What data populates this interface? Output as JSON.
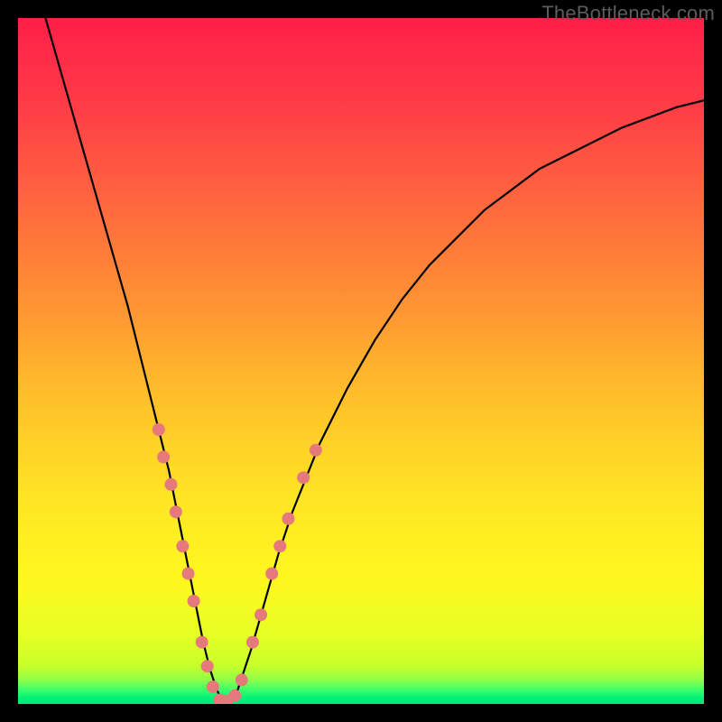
{
  "watermark": "TheBottleneck.com",
  "chart_data": {
    "type": "line",
    "title": "",
    "xlabel": "",
    "ylabel": "",
    "xlim": [
      0,
      100
    ],
    "ylim": [
      0,
      100
    ],
    "curve": {
      "name": "bottleneck-curve",
      "x": [
        4,
        6,
        8,
        10,
        12,
        14,
        16,
        18,
        20,
        22,
        24,
        26,
        27,
        28,
        29,
        30,
        31,
        32,
        34,
        36,
        38,
        40,
        44,
        48,
        52,
        56,
        60,
        64,
        68,
        72,
        76,
        80,
        84,
        88,
        92,
        96,
        100
      ],
      "y": [
        100,
        93,
        86,
        79,
        72,
        65,
        58,
        50,
        42,
        34,
        24,
        14,
        9,
        5,
        2,
        0,
        0,
        2,
        8,
        15,
        22,
        28,
        38,
        46,
        53,
        59,
        64,
        68,
        72,
        75,
        78,
        80,
        82,
        84,
        85.5,
        87,
        88
      ]
    },
    "dots": {
      "name": "highlight-points",
      "color": "#e6797b",
      "radius_px": 7,
      "points": [
        {
          "x": 20.5,
          "y": 40
        },
        {
          "x": 21.2,
          "y": 36
        },
        {
          "x": 22.3,
          "y": 32
        },
        {
          "x": 23.0,
          "y": 28
        },
        {
          "x": 24.0,
          "y": 23
        },
        {
          "x": 24.8,
          "y": 19
        },
        {
          "x": 25.6,
          "y": 15
        },
        {
          "x": 26.8,
          "y": 9
        },
        {
          "x": 27.6,
          "y": 5.5
        },
        {
          "x": 28.4,
          "y": 2.5
        },
        {
          "x": 29.4,
          "y": 0.6
        },
        {
          "x": 30.4,
          "y": 0.4
        },
        {
          "x": 31.6,
          "y": 1.2
        },
        {
          "x": 32.6,
          "y": 3.5
        },
        {
          "x": 34.2,
          "y": 9
        },
        {
          "x": 35.4,
          "y": 13
        },
        {
          "x": 37.0,
          "y": 19
        },
        {
          "x": 38.2,
          "y": 23
        },
        {
          "x": 39.4,
          "y": 27
        },
        {
          "x": 41.6,
          "y": 33
        },
        {
          "x": 43.4,
          "y": 37
        }
      ]
    },
    "green_band": {
      "y_center": 1.5,
      "thickness_pct": 3
    },
    "gradient_stops": [
      {
        "offset": 0.0,
        "color": "#ff1f47"
      },
      {
        "offset": 0.12,
        "color": "#ff3a47"
      },
      {
        "offset": 0.28,
        "color": "#ff6a3e"
      },
      {
        "offset": 0.42,
        "color": "#ff9433"
      },
      {
        "offset": 0.55,
        "color": "#ffbf2a"
      },
      {
        "offset": 0.7,
        "color": "#ffe524"
      },
      {
        "offset": 0.82,
        "color": "#fff81f"
      },
      {
        "offset": 0.9,
        "color": "#e6ff24"
      },
      {
        "offset": 0.945,
        "color": "#c8ff2a"
      },
      {
        "offset": 0.965,
        "color": "#8eff4a"
      },
      {
        "offset": 0.98,
        "color": "#38ff6c"
      },
      {
        "offset": 0.992,
        "color": "#00f07a"
      },
      {
        "offset": 1.0,
        "color": "#00e878"
      }
    ]
  }
}
